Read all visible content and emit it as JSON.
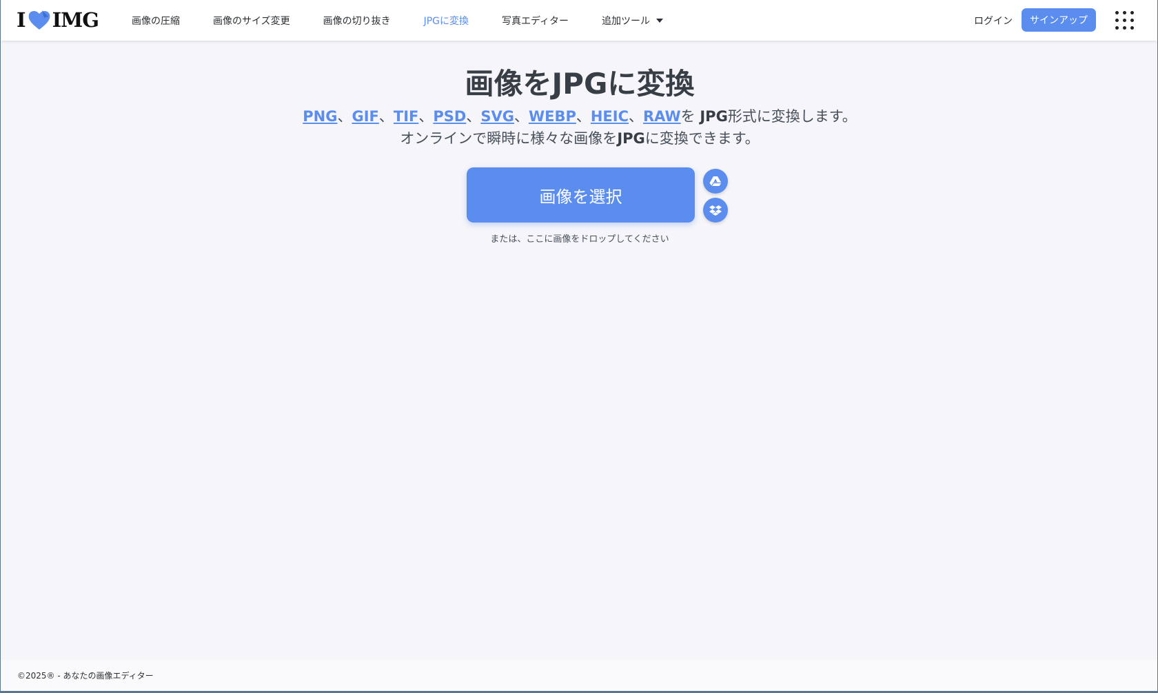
{
  "brand": {
    "logo_left": "I",
    "logo_right": "IMG",
    "heart_color": "#5b8def"
  },
  "nav": {
    "items": [
      {
        "label": "画像の圧縮",
        "active": false
      },
      {
        "label": "画像のサイズ変更",
        "active": false
      },
      {
        "label": "画像の切り抜き",
        "active": false
      },
      {
        "label": "JPGに変換",
        "active": true
      },
      {
        "label": "写真エディター",
        "active": false
      },
      {
        "label": "追加ツール",
        "active": false,
        "dropdown": true
      }
    ],
    "login": "ログイン",
    "signup": "サインアップ",
    "apps_icon": "grid-icon"
  },
  "main": {
    "title": "画像をJPGに変換",
    "formats": [
      "PNG",
      "GIF",
      "TIF",
      "PSD",
      "SVG",
      "WEBP",
      "HEIC",
      "RAW"
    ],
    "separator": "、",
    "line1_tail_a": "を ",
    "line1_tail_b": "JPG",
    "line1_tail_c": "形式に変換します。",
    "line2_a": "オンラインで瞬時に様々な画像を",
    "line2_b": "JPG",
    "line2_c": "に変換できます。",
    "select_button": "画像を選択",
    "drop_hint": "または、ここに画像をドロップしてください"
  },
  "footer": {
    "copyright": "©2025® - あなたの画像エディター"
  },
  "colors": {
    "accent": "#5b8def",
    "background": "#f5f5fa",
    "text": "#383e45"
  }
}
